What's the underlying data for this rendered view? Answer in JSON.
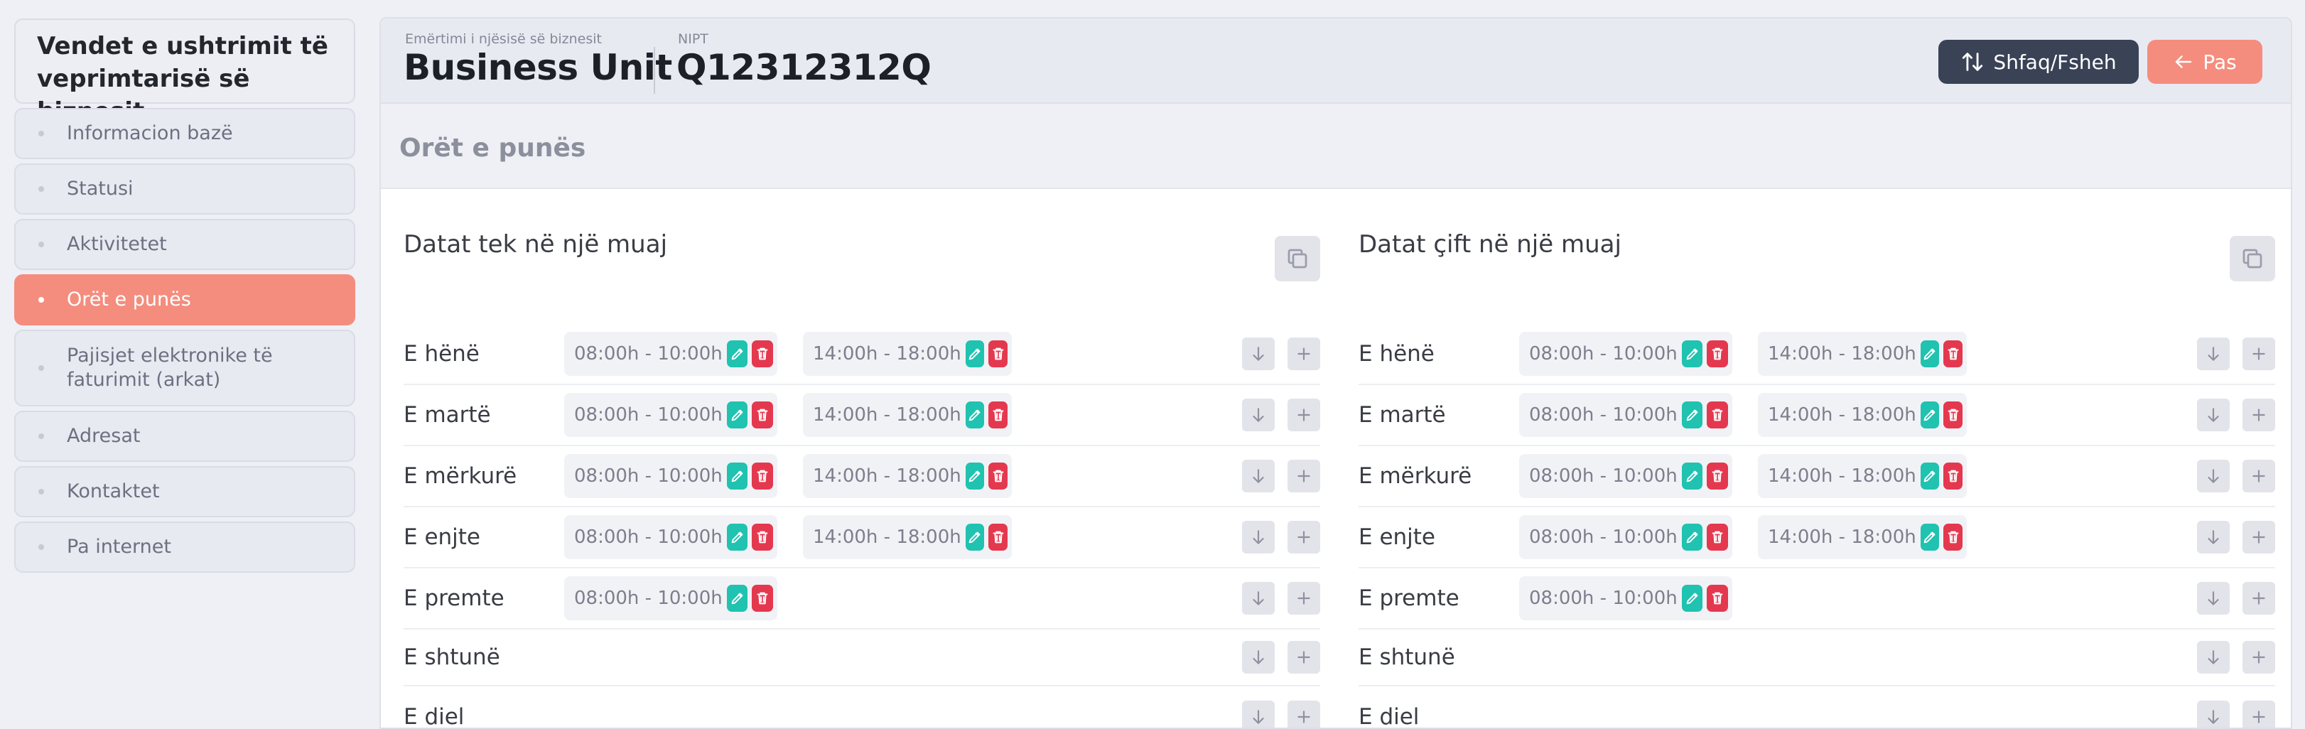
{
  "sidebar": {
    "title": "Vendet e ushtrimit të veprimtarisë së biznesit",
    "items": [
      {
        "label": "Informacion bazë",
        "active": false
      },
      {
        "label": "Statusi",
        "active": false
      },
      {
        "label": "Aktivitetet",
        "active": false
      },
      {
        "label": "Orët e punës",
        "active": true
      },
      {
        "label": "Pajisjet elektronike të faturimit (arkat)",
        "active": false
      },
      {
        "label": "Adresat",
        "active": false
      },
      {
        "label": "Kontaktet",
        "active": false
      },
      {
        "label": "Pa internet",
        "active": false
      }
    ]
  },
  "header": {
    "business_label": "Emërtimi i njësisë së biznesit",
    "business_value": "Business Unit",
    "nipt_label": "NIPT",
    "nipt_value": "Q12312312Q",
    "toggle_label": "Shfaq/Fsheh",
    "back_label": "Pas"
  },
  "section": {
    "title": "Orët e punës"
  },
  "panels": [
    {
      "title": "Datat tek në një muaj",
      "days": [
        {
          "name": "E hënë",
          "slots": [
            "08:00h - 10:00h",
            "14:00h - 18:00h"
          ]
        },
        {
          "name": "E martë",
          "slots": [
            "08:00h - 10:00h",
            "14:00h - 18:00h"
          ]
        },
        {
          "name": "E mërkurë",
          "slots": [
            "08:00h - 10:00h",
            "14:00h - 18:00h"
          ]
        },
        {
          "name": "E enjte",
          "slots": [
            "08:00h - 10:00h",
            "14:00h - 18:00h"
          ]
        },
        {
          "name": "E premte",
          "slots": [
            "08:00h - 10:00h"
          ]
        },
        {
          "name": "E shtunë",
          "slots": []
        },
        {
          "name": "E diel",
          "slots": []
        }
      ]
    },
    {
      "title": "Datat çift në një muaj",
      "days": [
        {
          "name": "E hënë",
          "slots": [
            "08:00h - 10:00h",
            "14:00h - 18:00h"
          ]
        },
        {
          "name": "E martë",
          "slots": [
            "08:00h - 10:00h",
            "14:00h - 18:00h"
          ]
        },
        {
          "name": "E mërkurë",
          "slots": [
            "08:00h - 10:00h",
            "14:00h - 18:00h"
          ]
        },
        {
          "name": "E enjte",
          "slots": [
            "08:00h - 10:00h",
            "14:00h - 18:00h"
          ]
        },
        {
          "name": "E premte",
          "slots": [
            "08:00h - 10:00h"
          ]
        },
        {
          "name": "E shtunë",
          "slots": []
        },
        {
          "name": "E diel",
          "slots": []
        }
      ]
    }
  ],
  "icons": {
    "toggle": "sort-arrows-icon",
    "back": "arrow-left-icon",
    "copy": "copy-icon",
    "edit": "pencil-icon",
    "delete": "trash-icon",
    "move_down": "arrow-down-icon",
    "add": "plus-icon"
  },
  "colors": {
    "accent": "#f48d7e",
    "dark_button": "#3a4256",
    "edit": "#20c2b0",
    "delete": "#e4384f"
  }
}
